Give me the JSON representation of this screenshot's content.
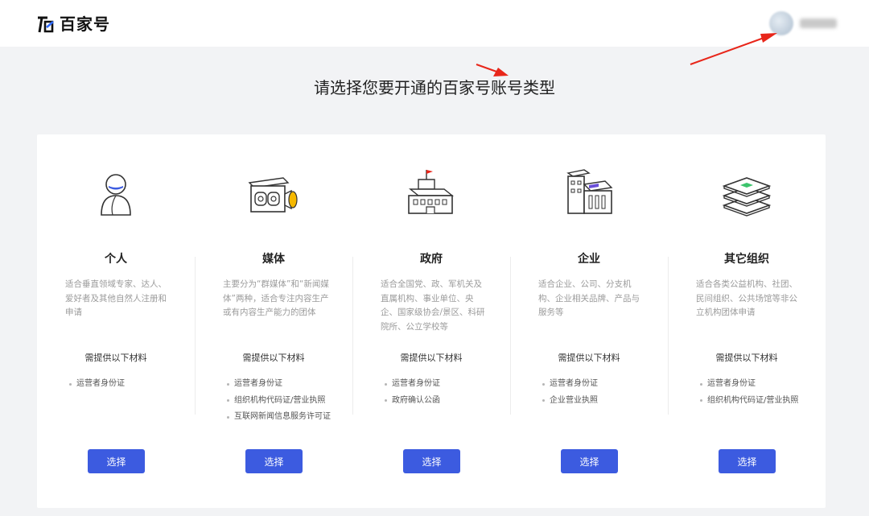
{
  "header": {
    "logo_text": "百家号",
    "user_name": ""
  },
  "page_title": "请选择您要开通的百家号账号类型",
  "colors": {
    "accent": "#3c5be0",
    "annotation_arrow": "#e8261a",
    "page_bg": "#f2f3f5",
    "icon_gold": "#f5b800",
    "icon_red": "#e8261a",
    "icon_green": "#3cc46c",
    "icon_purple": "#6a4fd8"
  },
  "cards": [
    {
      "title": "个人",
      "icon": "person-icon",
      "desc": "适合垂直领域专家、达人、爱好者及其他自然人注册和申请",
      "req_title": "需提供以下材料",
      "reqs": [
        "运营者身份证"
      ],
      "button": "选择"
    },
    {
      "title": "媒体",
      "icon": "camera-icon",
      "desc": "主要分为“群媒体”和“新闻媒体”两种，适合专注内容生产或有内容生产能力的团体",
      "req_title": "需提供以下材料",
      "reqs": [
        "运营者身份证",
        "组织机构代码证/营业执照",
        "互联网新闻信息服务许可证"
      ],
      "button": "选择"
    },
    {
      "title": "政府",
      "icon": "government-building-icon",
      "desc": "适合全国党、政、军机关及直属机构、事业单位、央企、国家级协会/景区、科研院所、公立学校等",
      "req_title": "需提供以下材料",
      "reqs": [
        "运营者身份证",
        "政府确认公函"
      ],
      "button": "选择"
    },
    {
      "title": "企业",
      "icon": "enterprise-building-icon",
      "desc": "适合企业、公司、分支机构、企业相关品牌、产品与服务等",
      "req_title": "需提供以下材料",
      "reqs": [
        "运营者身份证",
        "企业营业执照"
      ],
      "button": "选择"
    },
    {
      "title": "其它组织",
      "icon": "layers-icon",
      "desc": "适合各类公益机构、社团、民间组织、公共场馆等非公立机构团体申请",
      "req_title": "需提供以下材料",
      "reqs": [
        "运营者身份证",
        "组织机构代码证/营业执照"
      ],
      "button": "选择"
    }
  ]
}
